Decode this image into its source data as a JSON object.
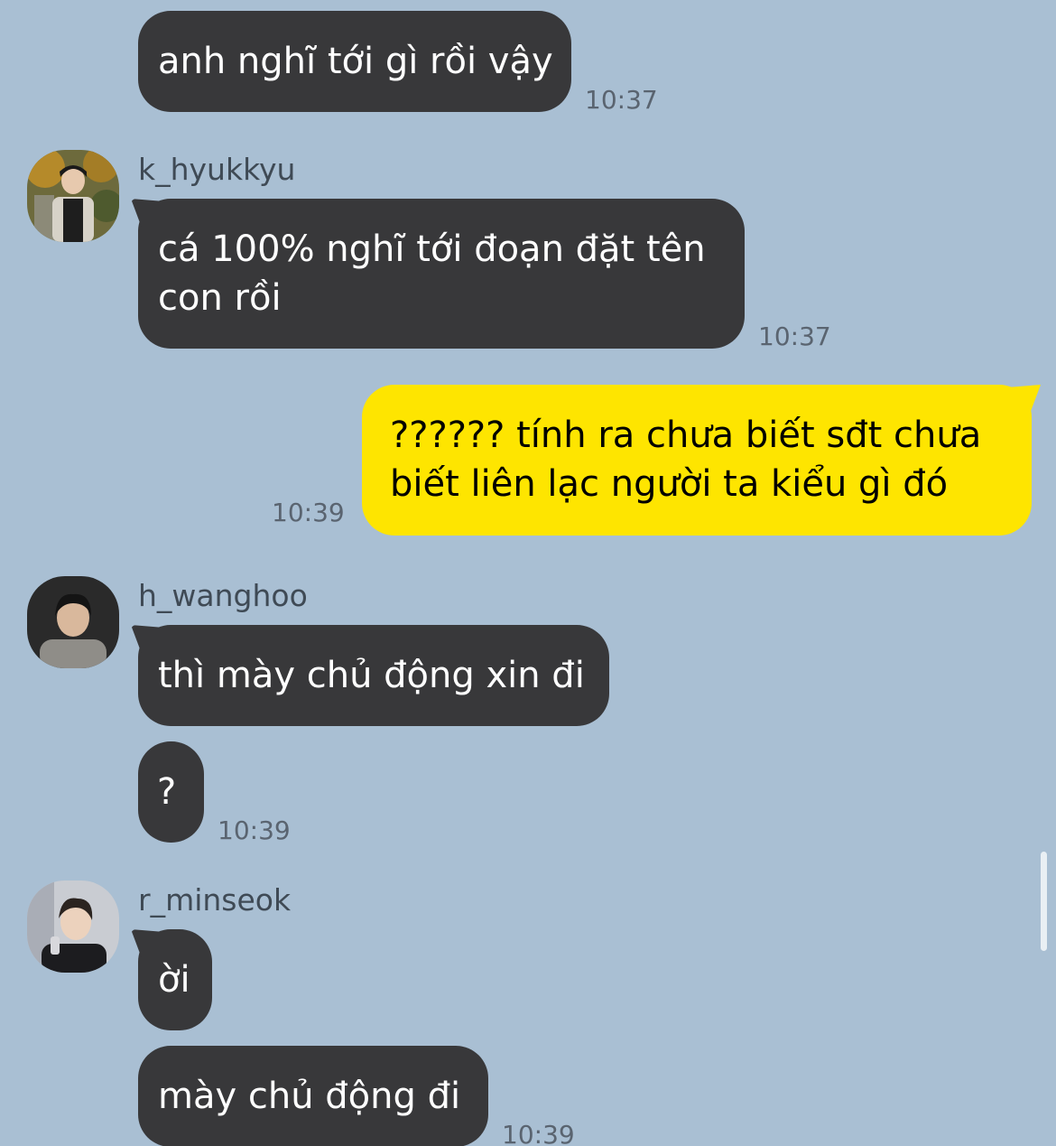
{
  "messages": {
    "m1": {
      "text": "anh nghĩ tới gì rồi vậy",
      "time": "10:37"
    },
    "m2": {
      "sender": "k_hyukkyu",
      "line1": "cá 100% nghĩ tới đoạn đặt tên",
      "line2": "con rồi",
      "time": "10:37"
    },
    "m3": {
      "line1": "?????? tính ra chưa biết sđt chưa",
      "line2": "biết liên lạc người ta kiểu gì đó",
      "time": "10:39"
    },
    "m4": {
      "sender": "h_wanghoo",
      "text1": "thì mày chủ động xin đi",
      "text2": "?",
      "time": "10:39"
    },
    "m5": {
      "sender": "r_minseok",
      "text1": "ời",
      "text2": "mày chủ động đi",
      "time": "10:39"
    }
  },
  "colors": {
    "background": "#a9bfd3",
    "incoming_bubble": "#38383a",
    "outgoing_bubble": "#fee500"
  }
}
